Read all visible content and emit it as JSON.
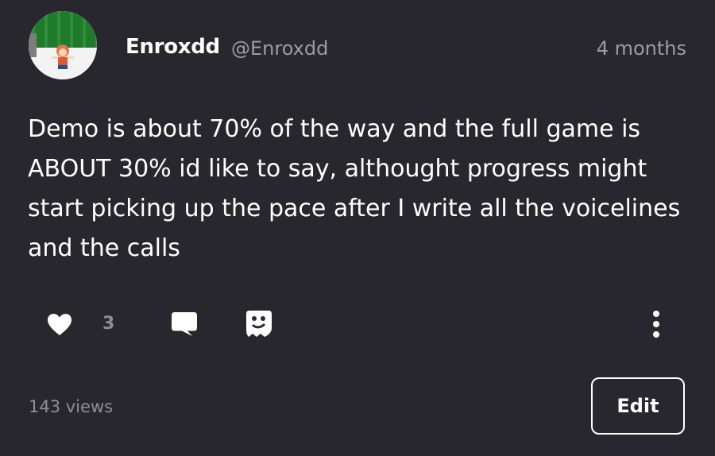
{
  "post": {
    "author_name": "Enroxdd",
    "author_handle": "@Enroxdd",
    "timestamp": "4 months",
    "text": "Demo is about 70% of the way and the full game is ABOUT 30% id like to say, althought progress might start picking up the pace after I write all the voicelines and the calls",
    "like_count": "3",
    "views": "143 views",
    "edit_label": "Edit"
  },
  "icons": {
    "like": "heart-icon",
    "comment": "comment-bubble-icon",
    "ghost": "ghost-icon",
    "more": "more-vertical-icon"
  },
  "colors": {
    "background": "#28272e",
    "text_primary": "#ffffff",
    "text_secondary": "#9d9ca4"
  }
}
